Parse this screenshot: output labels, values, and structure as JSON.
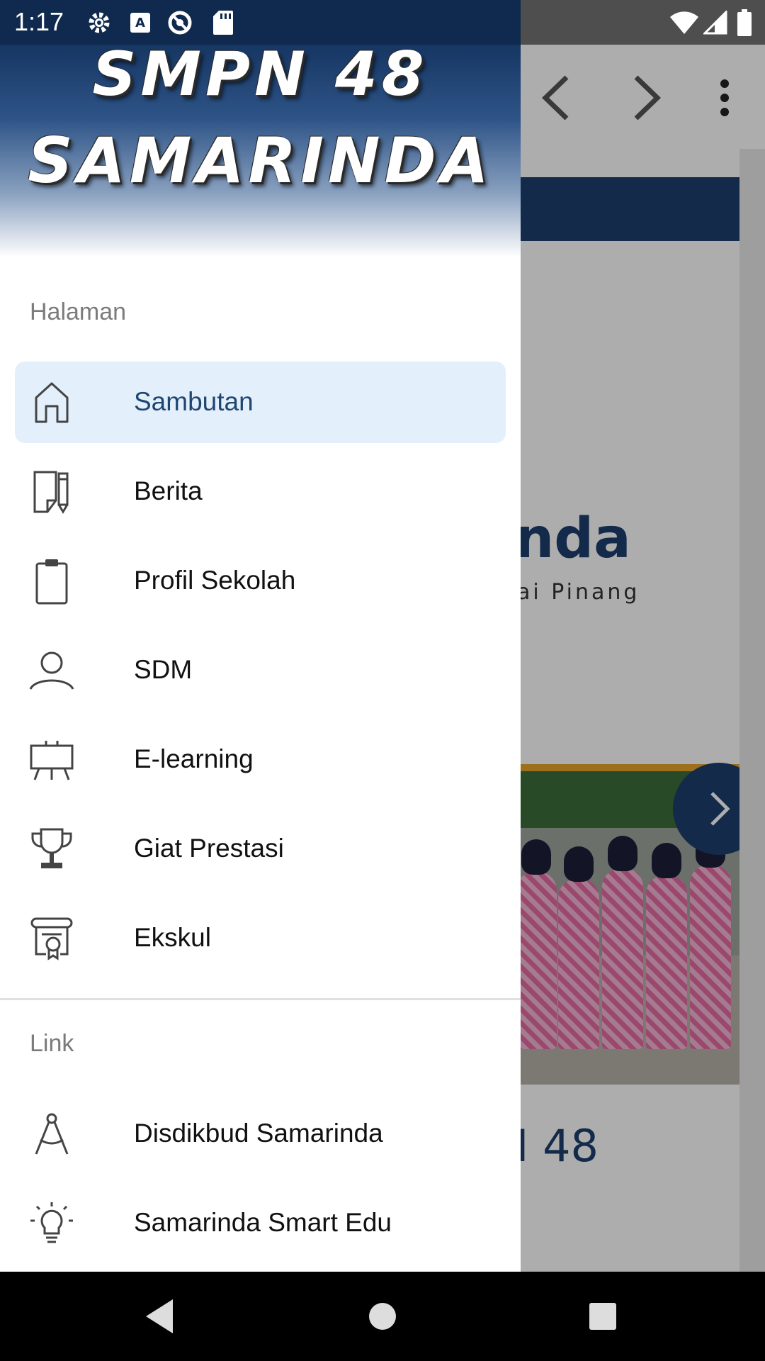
{
  "status_bar": {
    "time": "1:17",
    "left_icons": [
      "settings-icon",
      "keyboard-a-icon",
      "sync-disabled-icon",
      "sd-card-icon"
    ],
    "right_icons": [
      "wifi-icon",
      "cell-signal-icon",
      "battery-icon"
    ]
  },
  "drawer": {
    "header": {
      "line1": "SMPN 48",
      "line2": "SAMARINDA"
    },
    "sections": {
      "halaman": "Halaman",
      "link": "Link"
    },
    "items": [
      {
        "label": "Sambutan",
        "icon": "home-icon",
        "active": true
      },
      {
        "label": "Berita",
        "icon": "news-icon",
        "active": false
      },
      {
        "label": "Profil Sekolah",
        "icon": "clipboard-icon",
        "active": false
      },
      {
        "label": "SDM",
        "icon": "person-icon",
        "active": false
      },
      {
        "label": "E-learning",
        "icon": "presentation-board-icon",
        "active": false
      },
      {
        "label": "Giat Prestasi",
        "icon": "trophy-icon",
        "active": false
      },
      {
        "label": "Ekskul",
        "icon": "certificate-icon",
        "active": false
      }
    ],
    "links": [
      {
        "label": "Disdikbud Samarinda",
        "icon": "compass-icon"
      },
      {
        "label": "Samarinda Smart Edu",
        "icon": "lightbulb-icon"
      }
    ]
  },
  "background": {
    "title_fragment": "inda",
    "subtitle_fragment": "ai Pinang",
    "footer_fragment": "N 48"
  },
  "colors": {
    "brand": "#1d3f6e",
    "active_bg": "#e3f0fc",
    "active_text": "#1f4670"
  }
}
